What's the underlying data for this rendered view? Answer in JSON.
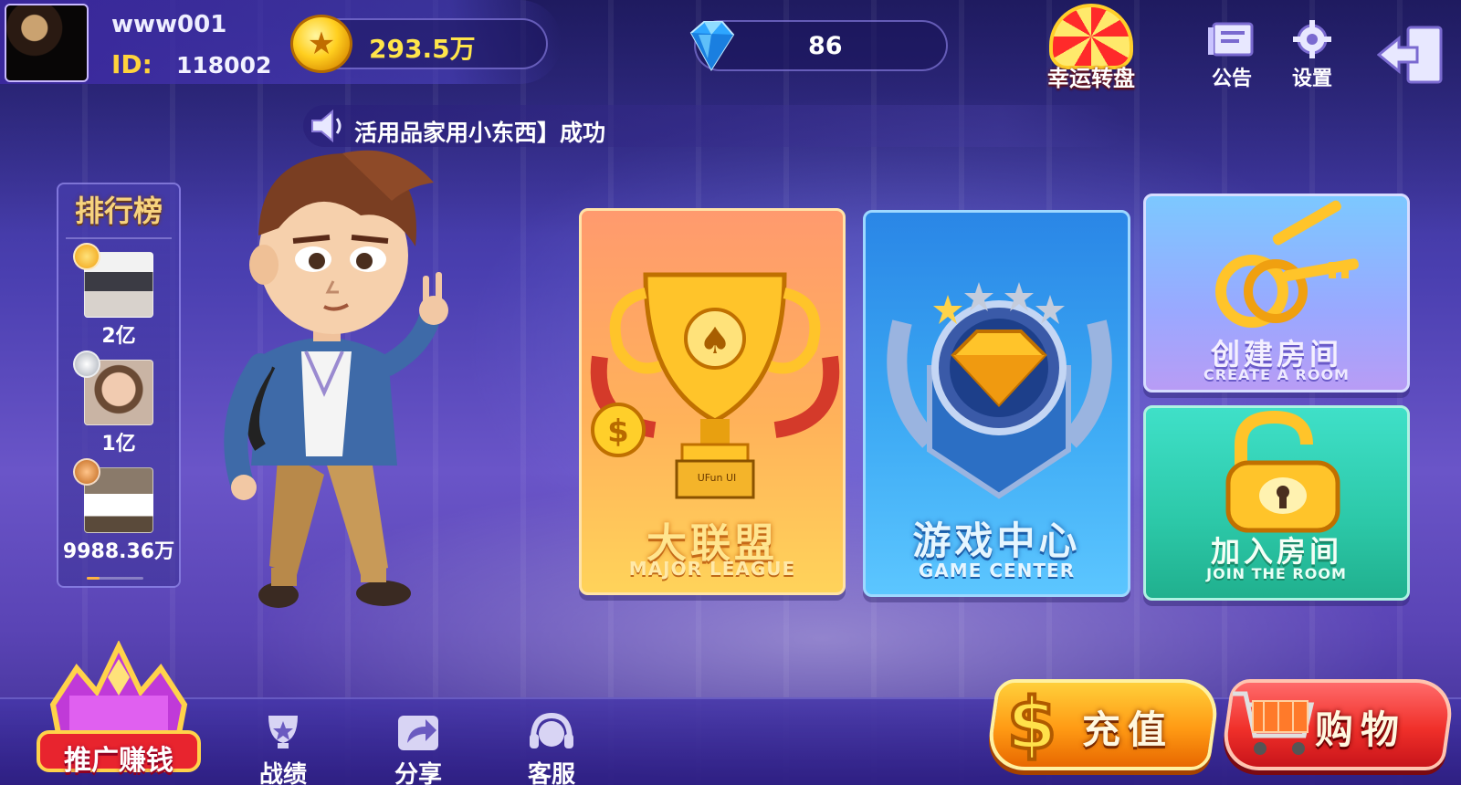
{
  "player": {
    "username": "www001",
    "id_label": "ID:",
    "id_value": "118002"
  },
  "currency": {
    "coins": "293.5万",
    "diamonds": "86"
  },
  "top_buttons": {
    "lucky_wheel": "幸运转盘",
    "notice": "公告",
    "settings": "设置"
  },
  "marquee": {
    "text": "活用品家用小东西】成功"
  },
  "ranking": {
    "title": "排行榜",
    "entries": [
      {
        "rank": 1,
        "medal": "gold",
        "value": "2亿"
      },
      {
        "rank": 2,
        "medal": "silver",
        "value": "1亿"
      },
      {
        "rank": 3,
        "medal": "bronze",
        "value": "9988.36万"
      }
    ]
  },
  "cards": {
    "major_league": {
      "title_cn": "大联盟",
      "title_en": "MAJOR LEAGUE",
      "trophy_text": "UFun UI"
    },
    "game_center": {
      "title_cn": "游戏中心",
      "title_en": "GAME CENTER"
    },
    "create_room": {
      "title_cn": "创建房间",
      "title_en": "CREATE A ROOM"
    },
    "join_room": {
      "title_cn": "加入房间",
      "title_en": "JOIN THE ROOM"
    }
  },
  "bottom": {
    "promote": "推广赚钱",
    "records": "战绩",
    "share": "分享",
    "service": "客服",
    "recharge": "充值",
    "shop": "购物"
  },
  "icons": [
    "coin-icon",
    "diamond-icon",
    "lucky-wheel-icon",
    "notice-icon",
    "settings-icon",
    "exit-icon",
    "speaker-icon",
    "trophy-icon",
    "emblem-icon",
    "keys-icon",
    "lock-icon",
    "crown-icon",
    "records-trophy-icon",
    "share-icon",
    "headset-icon",
    "dollar-icon",
    "cart-icon"
  ],
  "colors": {
    "coin_text": "#ffe54a",
    "id_label": "#ffd33c",
    "rank_title": "#f7d37e",
    "major_card": "#ffb25a",
    "game_center_card": "#3aa7f3",
    "create_room_card": "#9aa8ff",
    "join_room_card": "#2cc8a8",
    "recharge_button": "#ff9a14",
    "shop_button": "#f0302a"
  }
}
